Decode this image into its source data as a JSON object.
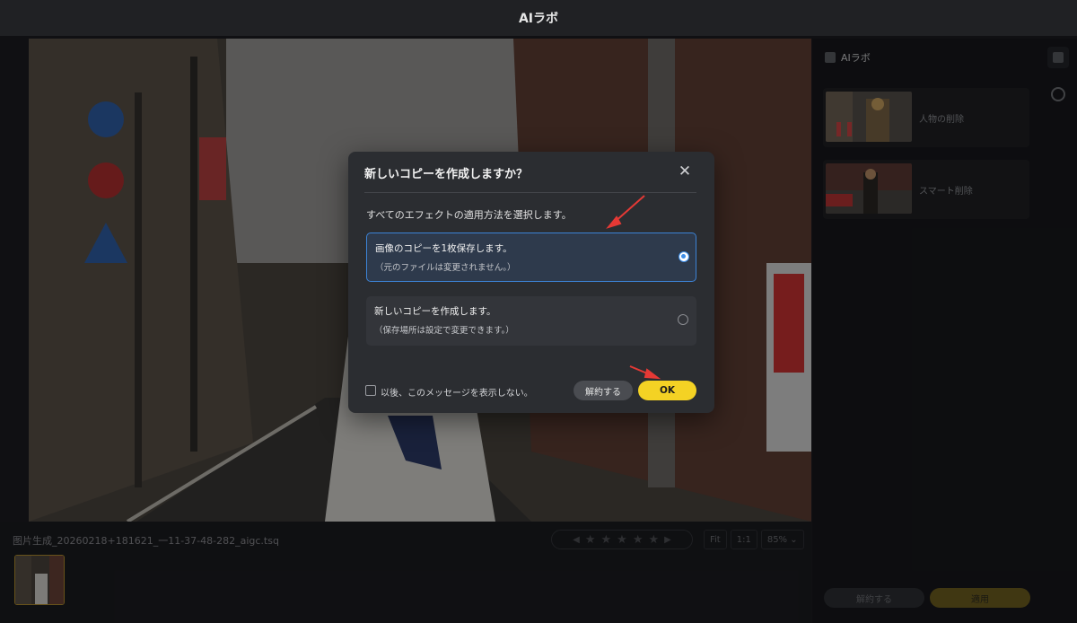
{
  "app": {
    "title": "AIラボ"
  },
  "file": {
    "name": "图片生成_20260218+181621_一11-37-48-282_aigc.tsq"
  },
  "toolbar": {
    "fit": "Fit",
    "one_to_one": "1:1",
    "zoom": "85%",
    "stars": 5,
    "rating": 0
  },
  "right_panel": {
    "title": "AIラボ",
    "tools": [
      {
        "label": "人物の削除"
      },
      {
        "label": "スマート削除"
      }
    ],
    "reset_label": "解約する",
    "apply_label": "適用"
  },
  "dialog": {
    "title": "新しいコピーを作成しますか？",
    "subtitle": "すべてのエフェクトの適用方法を選択します。",
    "options": [
      {
        "main": "画像のコピーを1枚保存します。",
        "note": "（元のファイルは変更されません。）",
        "selected": true
      },
      {
        "main": "新しいコピーを作成します。",
        "note": "（保存場所は設定で変更できます。）",
        "selected": false
      }
    ],
    "checkbox_label": "以後、このメッセージを表示しない。",
    "cancel_label": "解約する",
    "ok_label": "OK"
  },
  "colors": {
    "accent": "#f4d224",
    "selection": "#3c83d6",
    "annotation": "#e53935"
  }
}
